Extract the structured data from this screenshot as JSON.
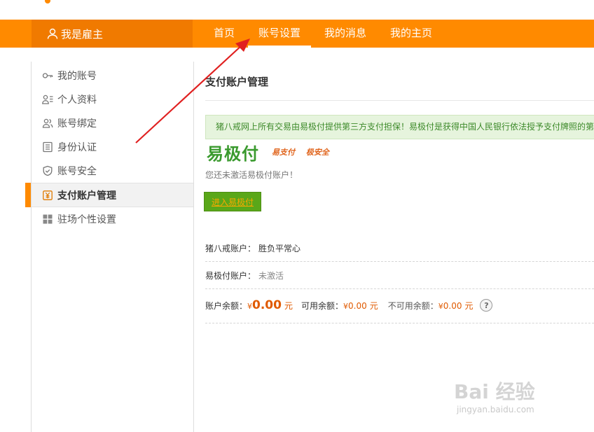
{
  "header": {
    "brand_label": "我是雇主",
    "nav": [
      {
        "label": "首页",
        "active": false
      },
      {
        "label": "账号设置",
        "active": true
      },
      {
        "label": "我的消息",
        "active": false
      },
      {
        "label": "我的主页",
        "active": false
      }
    ]
  },
  "sidebar": {
    "items": [
      {
        "label": "我的账号",
        "icon": "key-icon"
      },
      {
        "label": "个人资料",
        "icon": "profile-icon"
      },
      {
        "label": "账号绑定",
        "icon": "users-icon"
      },
      {
        "label": "身份认证",
        "icon": "id-card-icon"
      },
      {
        "label": "账号安全",
        "icon": "shield-icon"
      },
      {
        "label": "支付账户管理",
        "icon": "yuan-icon",
        "active": true
      },
      {
        "label": "驻场个性设置",
        "icon": "grid-icon"
      }
    ]
  },
  "main": {
    "title": "支付账户管理",
    "notice": "猪八戒网上所有交易由易极付提供第三方支付担保！易极付是获得中国人民银行依法授予支付牌照的第",
    "logo_text": "易极付",
    "slogan_1": "易支付",
    "slogan_2": "极安全",
    "not_activated": "您还未激活易极付账户！",
    "activate_button": "进入易极付",
    "zbj_account_label": "猪八戒账户：",
    "zbj_account_value": "胜负平常心",
    "yjf_account_label": "易极付账户：",
    "yjf_account_value": "未激活",
    "balance_label": "账户余额：",
    "balance_currency": "¥",
    "balance_value": "0.00",
    "balance_unit": "元",
    "available_label": "可用余额：",
    "available_currency": "¥",
    "available_value": "0.00",
    "available_unit": "元",
    "unavailable_label": "不可用余额：",
    "unavailable_currency": "¥",
    "unavailable_value": "0.00",
    "unavailable_unit": "元",
    "help_symbol": "?"
  },
  "watermark": {
    "main": "Bai 经验",
    "sub": "jingyan.baidu.com"
  },
  "colors": {
    "accent": "#ff8a00",
    "arrow": "#e02020",
    "success_green": "#5aa719",
    "money": "#e05a00"
  }
}
